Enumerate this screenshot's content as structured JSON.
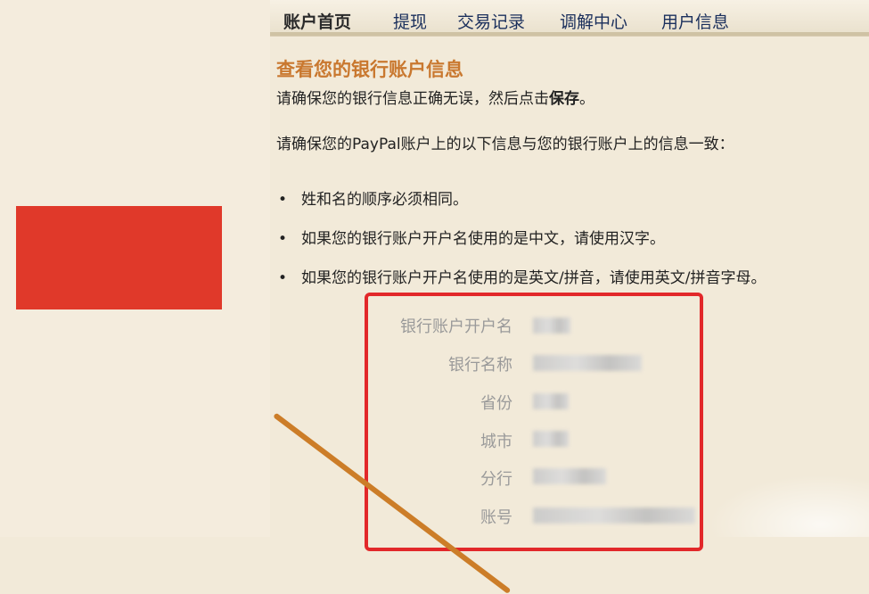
{
  "nav": {
    "tabs": [
      {
        "label": "账户首页",
        "active": true
      },
      {
        "label": "提现",
        "active": false
      },
      {
        "label": "交易记录",
        "active": false
      },
      {
        "label": "调解中心",
        "active": false
      },
      {
        "label": "用户信息",
        "active": false
      }
    ]
  },
  "main": {
    "title": "查看您的银行账户信息",
    "instruction_prefix": "请确保您的银行信息正确无误，然后点击",
    "instruction_bold": "保存",
    "instruction_suffix": "。",
    "intro": "请确保您的PayPal账户上的以下信息与您的银行账户上的信息一致：",
    "bullets": [
      "姓和名的顺序必须相同。",
      "如果您的银行账户开户名使用的是中文，请使用汉字。",
      "如果您的银行账户开户名使用的是英文/拼音，请使用英文/拼音字母。"
    ],
    "bullet_marker": "•",
    "fields": [
      {
        "label": "银行账户开户名"
      },
      {
        "label": "银行名称"
      },
      {
        "label": "省份"
      },
      {
        "label": "城市"
      },
      {
        "label": "分行"
      },
      {
        "label": "账号"
      }
    ]
  },
  "colors": {
    "accent": "#c9782f",
    "highlight": "#e2282a",
    "redact_block": "#e0392a",
    "link": "#1a2f5c"
  }
}
